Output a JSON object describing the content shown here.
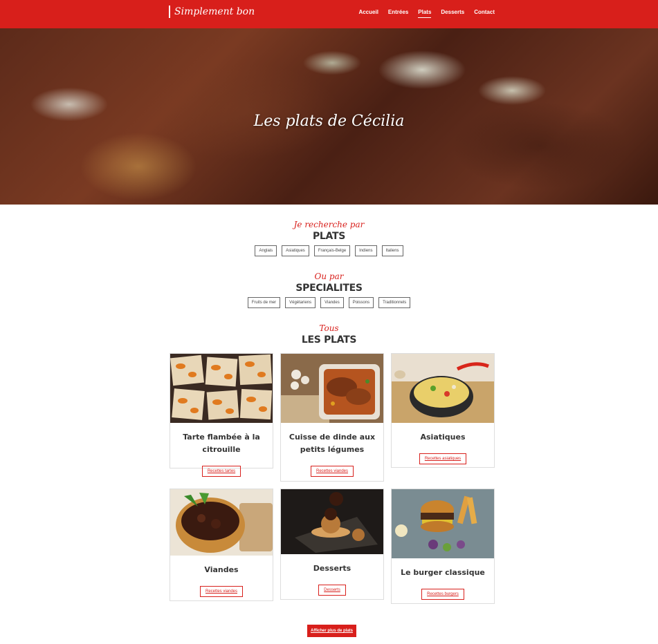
{
  "header": {
    "brand": "Simplement bon",
    "nav": [
      {
        "label": "Accueil"
      },
      {
        "label": "Entrées"
      },
      {
        "label": "Plats"
      },
      {
        "label": "Desserts"
      },
      {
        "label": "Contact"
      }
    ],
    "active_nav": "Plats"
  },
  "hero": {
    "title": "Les plats de Cécilia"
  },
  "search_plats": {
    "script": "Je recherche par",
    "heading": "PLATS",
    "tags": [
      "Anglais",
      "Asiatiques",
      "Français-Belge",
      "Indiens",
      "Italiens"
    ]
  },
  "search_specialites": {
    "script": "Ou par",
    "heading": "SPECIALITES",
    "tags": [
      "Fruits de mer",
      "Végétariens",
      "Viandes",
      "Poissons",
      "Traditionnels"
    ]
  },
  "all_plats": {
    "script": "Tous",
    "heading": "LES PLATS",
    "cards": [
      {
        "title": "Tarte flambée à la citrouille",
        "button": "Recettes tartes",
        "image": "pumpkin-tart-photo"
      },
      {
        "title": "Cuisse de dinde aux petits légumes",
        "button": "Recettes viandes",
        "image": "turkey-leg-photo"
      },
      {
        "title": "Asiatiques",
        "button": "Recettes asiatiques",
        "image": "noodles-bowl-photo"
      },
      {
        "title": "Viandes",
        "button": "Recettes viandes",
        "image": "beef-stew-photo"
      },
      {
        "title": "Desserts",
        "button": "Desserts",
        "image": "choux-dessert-photo"
      },
      {
        "title": "Le burger classique",
        "button": "Recettes burgers",
        "image": "burger-photo"
      }
    ]
  },
  "more_button": "Afficher plus de plats",
  "colors": {
    "brand_red": "#d81f1b"
  }
}
